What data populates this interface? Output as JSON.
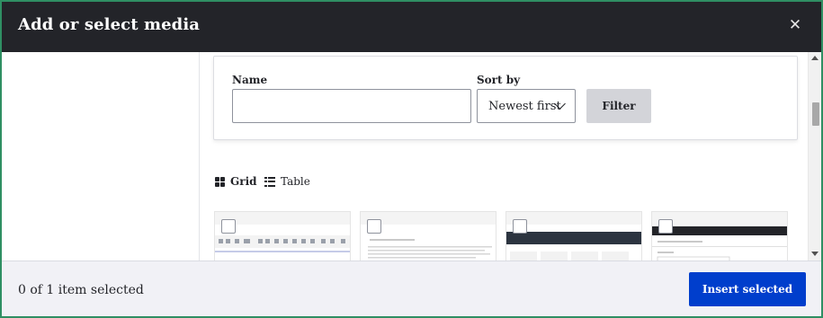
{
  "dialog": {
    "title": "Add or select media",
    "close_icon": "close-icon"
  },
  "filters": {
    "name_label": "Name",
    "name_value": "",
    "name_placeholder": "",
    "sort_label": "Sort by",
    "sort_value": "Newest first",
    "filter_button": "Filter"
  },
  "view_toggle": {
    "grid_label": "Grid",
    "grid_icon": "grid-icon",
    "table_label": "Table",
    "table_icon": "list-icon"
  },
  "footer": {
    "selection_status": "0 of 1 item selected",
    "insert_button": "Insert selected"
  },
  "colors": {
    "titlebar_bg": "#232429",
    "primary_button": "#003ecc",
    "secondary_button": "#d3d4d9",
    "footer_bg": "#f1f1f6",
    "outer_border": "#2f8f63"
  }
}
